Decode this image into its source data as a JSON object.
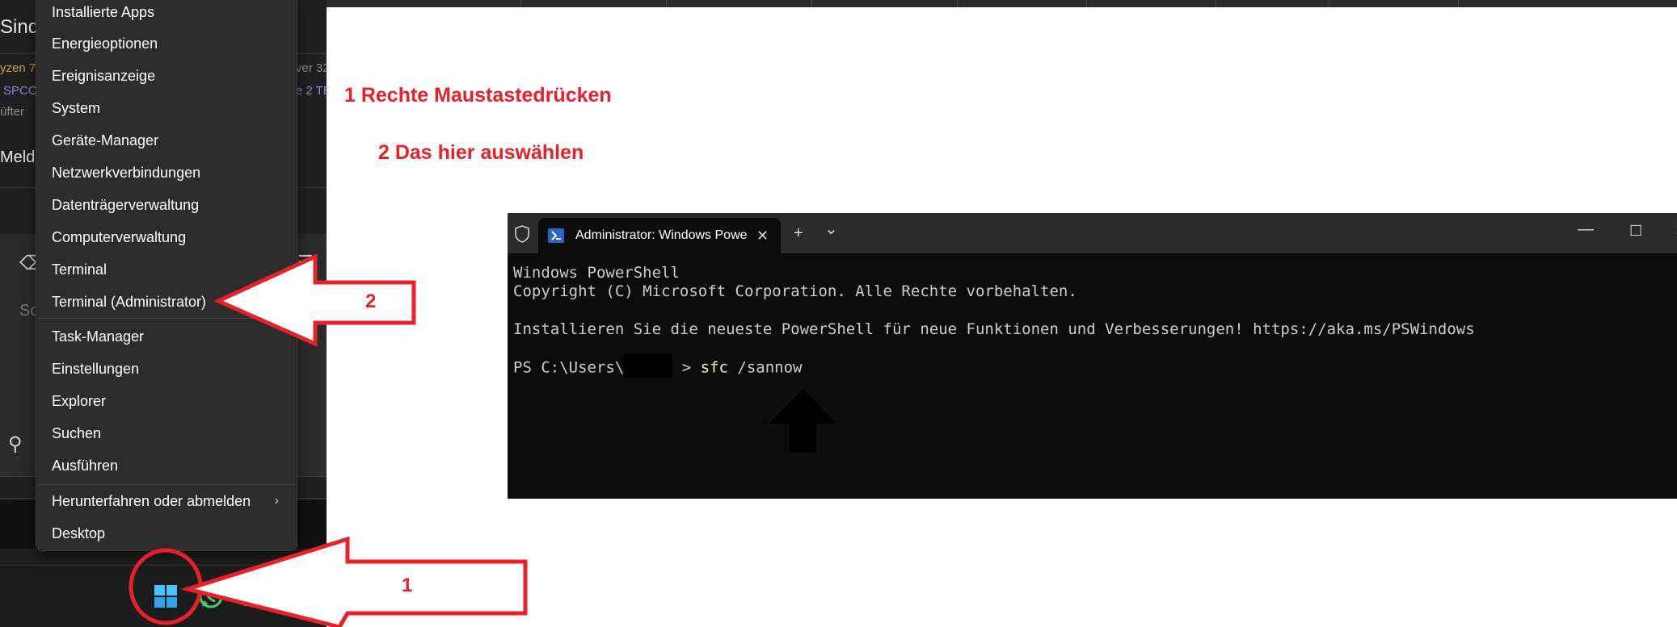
{
  "background_app": {
    "fragments": [
      "Sind",
      "yzen 7",
      "ver 32",
      "SPCC",
      "e 2 TB",
      "üfter",
      "Melde",
      "Sc"
    ]
  },
  "context_menu": {
    "items": [
      {
        "label": "Installierte Apps"
      },
      {
        "label": "Energieoptionen"
      },
      {
        "label": "Ereignisanzeige"
      },
      {
        "label": "System"
      },
      {
        "label": "Geräte-Manager"
      },
      {
        "label": "Netzwerkverbindungen"
      },
      {
        "label": "Datenträgerverwaltung"
      },
      {
        "label": "Computerverwaltung"
      },
      {
        "label": "Terminal"
      },
      {
        "label": "Terminal (Administrator)"
      },
      {
        "label": "Task-Manager"
      },
      {
        "label": "Einstellungen"
      },
      {
        "label": "Explorer"
      },
      {
        "label": "Suchen"
      },
      {
        "label": "Ausführen"
      },
      {
        "label": "Herunterfahren oder abmelden"
      },
      {
        "label": "Desktop"
      }
    ]
  },
  "annotations": {
    "step1_text": "1  Rechte Maustastedrücken",
    "step2_text": "2 Das hier auswählen",
    "arrow2_label": "2",
    "arrow1_label": "1"
  },
  "terminal": {
    "tab_title": "Administrator: Windows PowerShell",
    "new_tab": "+",
    "dropdown": "⌄",
    "lines": {
      "l1": "Windows PowerShell",
      "l2": "Copyright (C) Microsoft Corporation. Alle Rechte vorbehalten.",
      "l3": "Installieren Sie die neueste PowerShell für neue Funktionen und Verbesserungen! https://aka.ms/PSWindows",
      "prompt_start": "PS C:\\Users\\",
      "prompt_end": " > ",
      "command": "sfc",
      "command_arg": " /sannow"
    }
  },
  "taskbar": {
    "icons": [
      "windows-start-icon",
      "whatsapp-icon",
      "file-explorer-icon",
      "settings-icon"
    ]
  },
  "colors": {
    "annotation_red": "#e8202a",
    "terminal_bg": "#0c0c0c",
    "menu_bg": "#2c2c2c",
    "command_yellow": "#f9f1a5"
  }
}
